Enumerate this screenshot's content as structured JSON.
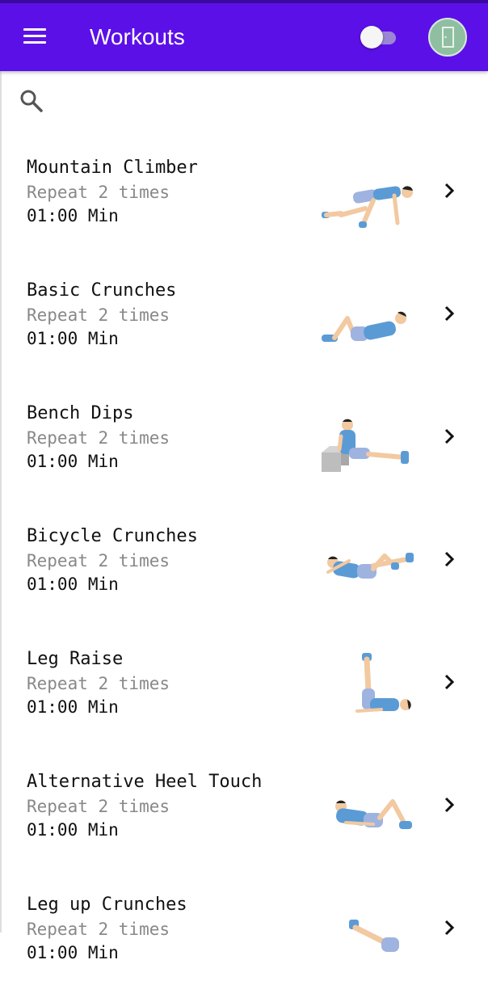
{
  "appbar": {
    "title": "Workouts",
    "menu_icon": "hamburger-menu-icon",
    "toggle_state": "off",
    "avatar_icon": "door-icon"
  },
  "search": {
    "icon": "search-icon"
  },
  "colors": {
    "appbar": "#5c10e8",
    "shirt": "#5b9bd5",
    "shorts": "#9fb3e0",
    "skin": "#f2c9a0"
  },
  "workouts": [
    {
      "name": "Mountain Climber",
      "repeat": "Repeat 2 times",
      "duration": "01:00 Min"
    },
    {
      "name": "Basic Crunches",
      "repeat": "Repeat 2 times",
      "duration": "01:00 Min"
    },
    {
      "name": "Bench Dips",
      "repeat": "Repeat 2 times",
      "duration": "01:00 Min"
    },
    {
      "name": "Bicycle Crunches",
      "repeat": "Repeat 2 times",
      "duration": "01:00 Min"
    },
    {
      "name": "Leg Raise",
      "repeat": "Repeat 2 times",
      "duration": "01:00 Min"
    },
    {
      "name": "Alternative Heel Touch",
      "repeat": "Repeat 2 times",
      "duration": "01:00 Min"
    },
    {
      "name": "Leg up Crunches",
      "repeat": "Repeat 2 times",
      "duration": "01:00 Min"
    }
  ]
}
